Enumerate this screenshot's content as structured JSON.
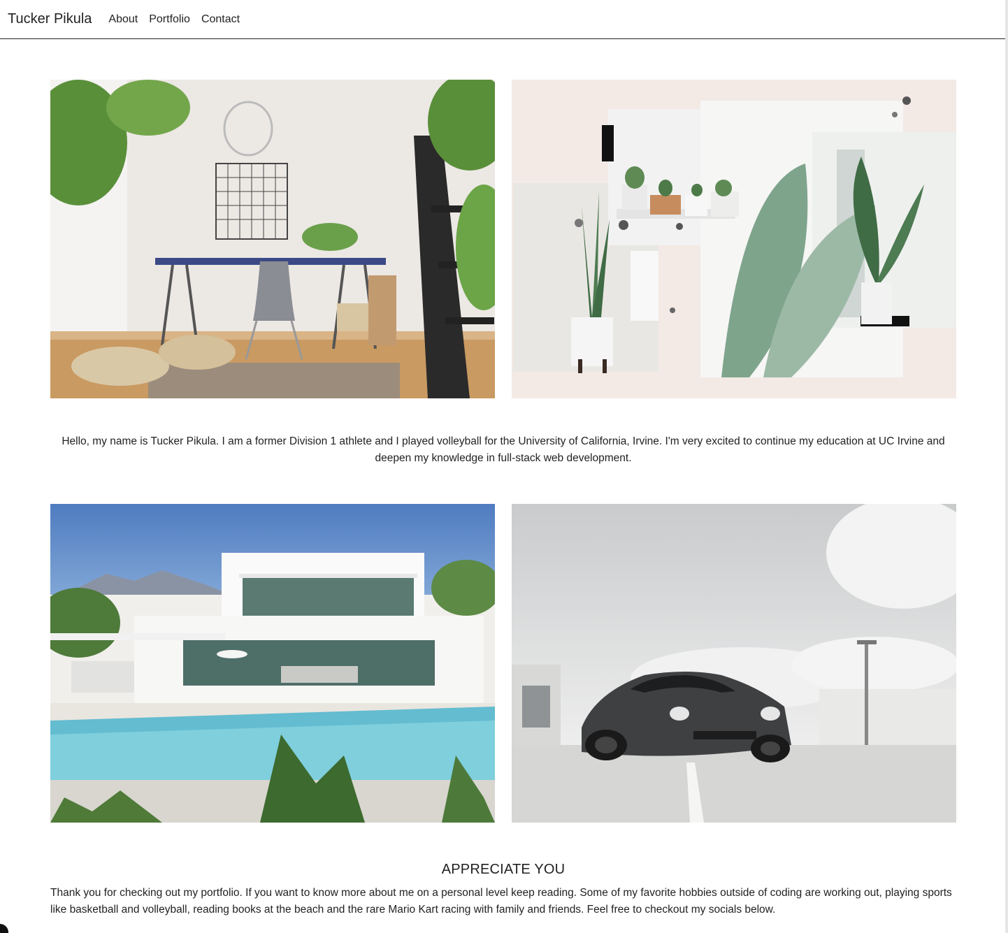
{
  "nav": {
    "brand": "Tucker Pikula",
    "links": [
      "About",
      "Portfolio",
      "Contact"
    ]
  },
  "gallery_top": [
    {
      "name": "workspace-photo",
      "description": "Bright home office with desk, chair and plants"
    },
    {
      "name": "plants-collage-photo",
      "description": "Collage of potted plants and leaves"
    }
  ],
  "intro_text": "Hello, my name is Tucker Pikula. I am a former Division 1 athlete and I played volleyball for the University of California, Irvine. I'm very excited to continue my education at UC Irvine and deepen my knowledge in full-stack web development.",
  "gallery_bottom": [
    {
      "name": "modern-house-photo",
      "description": "Modern white villa with swimming pool"
    },
    {
      "name": "sports-car-photo",
      "description": "Dark sports car on rooftop parking"
    }
  ],
  "appreciate": {
    "heading": "APPRECIATE YOU",
    "text": "Thank you for checking out my portfolio. If you want to know more about me on a personal level keep reading. Some of my favorite hobbies outside of coding are working out, playing sports like basketball and volleyball, reading books at the beach and the rare Mario Kart racing with family and friends. Feel free to checkout my socials below."
  }
}
